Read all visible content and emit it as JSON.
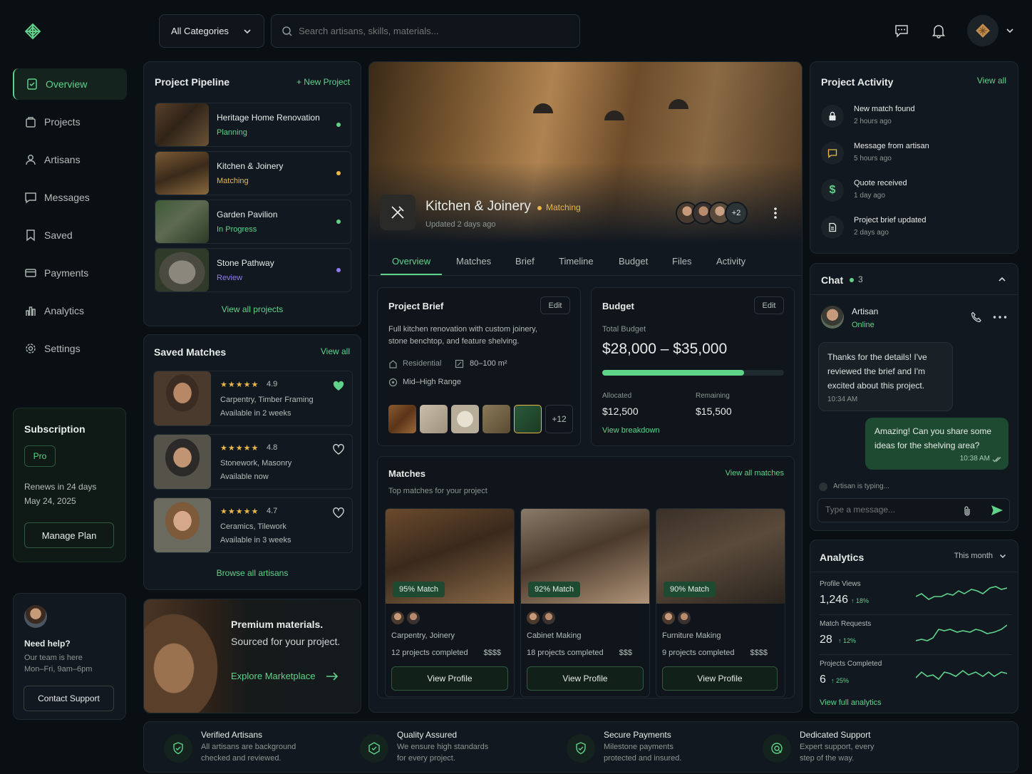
{
  "header": {
    "category": "All Categories",
    "search_placeholder": "Search artisans, skills, materials..."
  },
  "sidebar": {
    "items": [
      {
        "label": "Overview",
        "icon": "overview-icon",
        "active": true
      },
      {
        "label": "Projects",
        "icon": "projects-icon"
      },
      {
        "label": "Artisans",
        "icon": "artisans-icon"
      },
      {
        "label": "Messages",
        "icon": "messages-icon"
      },
      {
        "label": "Saved",
        "icon": "bookmark-icon"
      },
      {
        "label": "Payments",
        "icon": "payments-icon"
      },
      {
        "label": "Analytics",
        "icon": "analytics-icon"
      },
      {
        "label": "Settings",
        "icon": "settings-icon"
      }
    ],
    "subscription": {
      "title": "Subscription",
      "plan": "Pro",
      "renews": "Renews in 24 days",
      "date": "May 24, 2025",
      "manage": "Manage Plan"
    },
    "help": {
      "title": "Need help?",
      "line1": "Our team is here",
      "line2": "Mon–Fri, 9am–6pm",
      "contact": "Contact Support"
    }
  },
  "pipeline": {
    "title": "Project Pipeline",
    "new_label": "+ New Project",
    "view_all": "View all projects",
    "items": [
      {
        "name": "Heritage Home Renovation",
        "status": "Planning",
        "dot": "#5fd38a"
      },
      {
        "name": "Kitchen & Joinery",
        "status": "Matching",
        "dot": "#e8b84a"
      },
      {
        "name": "Garden Pavilion",
        "status": "In Progress",
        "dot": "#5fd38a"
      },
      {
        "name": "Stone Pathway",
        "status": "Review",
        "dot": "#8f7cf2"
      }
    ]
  },
  "saved": {
    "title": "Saved Matches",
    "view_all": "View all",
    "browse": "Browse all artisans",
    "items": [
      {
        "rating": "4.9",
        "skills": "Carpentry, Timber Framing",
        "avail": "Available in 2 weeks",
        "fav": true
      },
      {
        "rating": "4.8",
        "skills": "Stonework, Masonry",
        "avail": "Available now",
        "fav": false
      },
      {
        "rating": "4.7",
        "skills": "Ceramics, Tilework",
        "avail": "Available in 3 weeks",
        "fav": false
      }
    ]
  },
  "promo": {
    "title": "Premium materials.",
    "subtitle": "Sourced for your project.",
    "cta": "Explore Marketplace"
  },
  "project": {
    "name": "Kitchen & Joinery",
    "status": "Matching",
    "updated": "Updated 2 days ago",
    "extra_avatars": "+2",
    "tabs": [
      "Overview",
      "Matches",
      "Brief",
      "Timeline",
      "Budget",
      "Files",
      "Activity"
    ]
  },
  "brief": {
    "title": "Project Brief",
    "edit": "Edit",
    "text": "Full kitchen renovation with custom joinery, stone benchtop, and feature shelving.",
    "type": "Residential",
    "area": "80–100 m²",
    "range": "Mid–High Range",
    "more": "+12"
  },
  "budget": {
    "title": "Budget",
    "edit": "Edit",
    "total_label": "Total Budget",
    "total": "$28,000 – $35,000",
    "progress": 0.78,
    "allocated_label": "Allocated",
    "allocated": "$12,500",
    "remaining_label": "Remaining",
    "remaining": "$15,500",
    "breakdown": "View breakdown"
  },
  "matches": {
    "title": "Matches",
    "subtitle": "Top matches for your project",
    "view_all": "View all matches",
    "items": [
      {
        "match": "95% Match",
        "skills": "Carpentry, Joinery",
        "projects": "12 projects completed",
        "price": "$$$$",
        "cta": "View Profile"
      },
      {
        "match": "92% Match",
        "skills": "Cabinet Making",
        "projects": "18 projects completed",
        "price": "$$$",
        "cta": "View Profile"
      },
      {
        "match": "90% Match",
        "skills": "Furniture Making",
        "projects": "9 projects completed",
        "price": "$$$$",
        "cta": "View Profile"
      }
    ]
  },
  "activity": {
    "title": "Project Activity",
    "view_all": "View all",
    "items": [
      {
        "title": "New match found",
        "time": "2 hours ago",
        "icon": "lock-icon"
      },
      {
        "title": "Message from artisan",
        "time": "5 hours ago",
        "icon": "message-icon"
      },
      {
        "title": "Quote received",
        "time": "1 day ago",
        "icon": "dollar-icon"
      },
      {
        "title": "Project brief updated",
        "time": "2 days ago",
        "icon": "document-icon"
      }
    ]
  },
  "chat": {
    "title": "Chat",
    "count": "3",
    "name": "Artisan",
    "status": "Online",
    "msg_in": "Thanks for the details! I've reviewed the brief and I'm excited about this project.",
    "msg_in_time": "10:34 AM",
    "msg_out": "Amazing! Can you share some ideas for the shelving area?",
    "msg_out_time": "10:38 AM",
    "typing": "Artisan is typing...",
    "placeholder": "Type a message..."
  },
  "analytics": {
    "title": "Analytics",
    "period": "This month",
    "full": "View full analytics",
    "items": [
      {
        "label": "Profile Views",
        "value": "1,246",
        "delta": "↑ 18%"
      },
      {
        "label": "Match Requests",
        "value": "28",
        "delta": "↑ 12%"
      },
      {
        "label": "Projects Completed",
        "value": "6",
        "delta": "↑ 25%"
      }
    ]
  },
  "features": [
    {
      "title": "Verified Artisans",
      "l1": "All artisans are background",
      "l2": "checked and reviewed."
    },
    {
      "title": "Quality Assured",
      "l1": "We ensure high standards",
      "l2": "for every project."
    },
    {
      "title": "Secure Payments",
      "l1": "Milestone payments",
      "l2": "protected and insured."
    },
    {
      "title": "Dedicated Support",
      "l1": "Expert support, every",
      "l2": "step of the way."
    }
  ],
  "colors": {
    "accent": "#5fd38a",
    "bg": "#0a0f14",
    "card": "#111820",
    "matching": "#e8b84a",
    "review": "#8f7cf2"
  }
}
